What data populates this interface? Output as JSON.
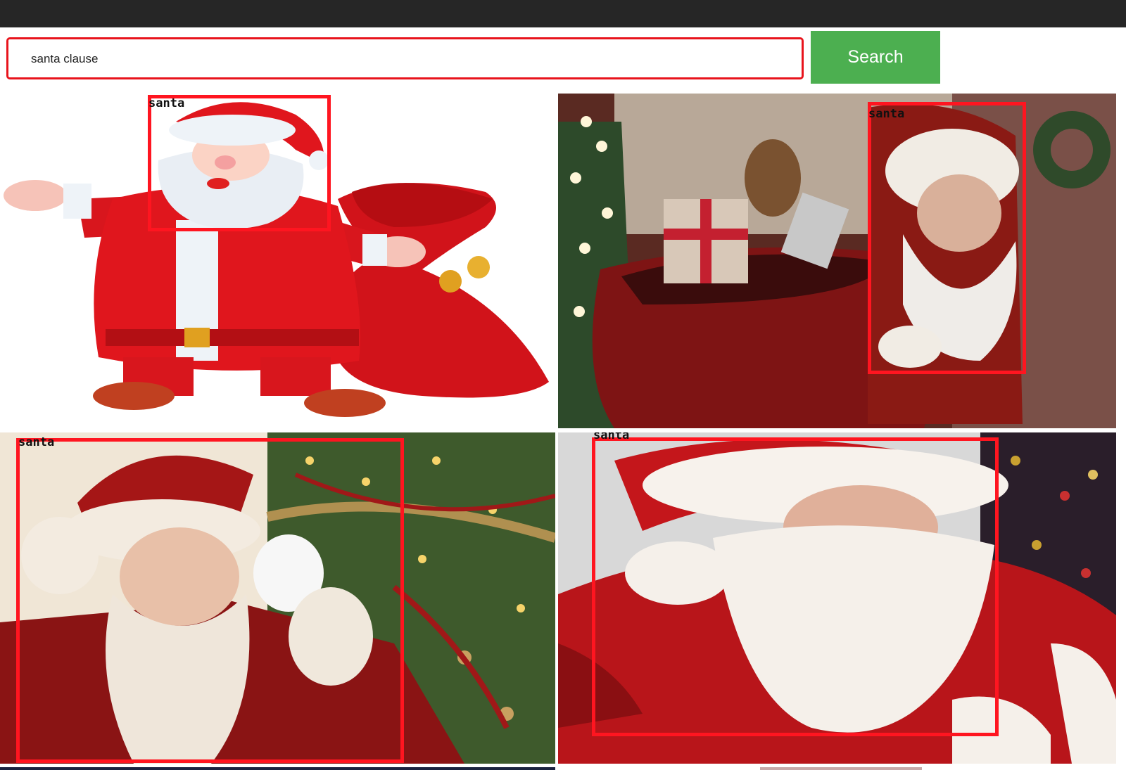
{
  "search": {
    "value": "santa clause",
    "button_label": "Search"
  },
  "results": [
    {
      "label": "santa",
      "style": "cartoon"
    },
    {
      "label": "santa",
      "style": "photo-with-gift-sack"
    },
    {
      "label": "santa",
      "style": "photo-adjusting-glasses"
    },
    {
      "label": "santa",
      "style": "photo-close-up"
    }
  ],
  "colors": {
    "topbar": "#262626",
    "search_border": "#e8141c",
    "search_button": "#4caf50",
    "bounding_box": "#ff1520"
  }
}
